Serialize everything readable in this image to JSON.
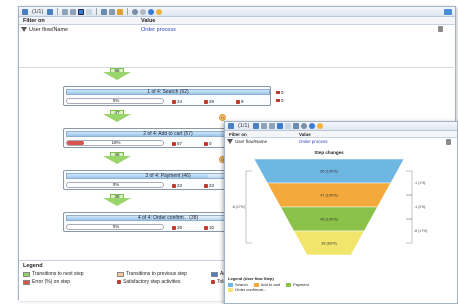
{
  "main": {
    "toolbar": {
      "page_label": "(1/1)"
    },
    "filter": {
      "col_filter_on": "Filter on",
      "col_value": "Value",
      "row_filter_on": "User flow/Name",
      "row_value": "Order process"
    },
    "steps": [
      {
        "title": "1 of 4: Search (62)",
        "pct": "0%",
        "pct_value": 0,
        "a": "24",
        "b": "29",
        "c": "9",
        "exit": "0",
        "entry_arrow": "66"
      },
      {
        "title": "2 of 4: Add to cart (57)",
        "pct": "18%",
        "pct_value": 18,
        "a": "57",
        "b": "0",
        "c": "",
        "exit": "",
        "entry_arrow": "47"
      },
      {
        "title": "3 of 4: Payment (46)",
        "pct": "0%",
        "pct_value": 0,
        "a": "23",
        "b": "23",
        "c": "",
        "exit": "",
        "entry_arrow": "46"
      },
      {
        "title": "4 of 4: Order confirm... (38)",
        "pct": "0%",
        "pct_value": 0,
        "a": "28",
        "b": "10",
        "c": "",
        "exit": "",
        "entry_arrow": "38"
      }
    ],
    "side_exit_first": "0",
    "side_dots": [
      "0",
      "0"
    ],
    "legend": {
      "title": "Legend",
      "items": [
        "Transitions to next step",
        "Transitions to previous step",
        "Activ",
        "Error (%) on step",
        "Satisfactory step activities",
        "Toler"
      ]
    }
  },
  "overlay": {
    "toolbar": {
      "page_label": "(1/1)"
    },
    "filter": {
      "col_filter_on": "Filter on",
      "col_value": "Value",
      "row_filter_on": "User flow/Name",
      "row_value": "Order process"
    },
    "legend": {
      "title": "Legend (User flow Step)",
      "items": [
        "Search",
        "Add to cart",
        "Payment",
        "Order confirmat..."
      ]
    }
  },
  "colors": {
    "accent_blue": "#2a3fb8",
    "step_search": "#6fb7e3",
    "step_cart": "#f3a93b",
    "step_payment": "#8bc34a",
    "step_order": "#f2e56b",
    "error_red": "#d9534f"
  },
  "chart_data": {
    "type": "funnel",
    "title": "Step changes",
    "categories": [
      "Search",
      "Add to cart",
      "Payment",
      "Order confirmat..."
    ],
    "values": [
      66,
      47,
      46,
      38
    ],
    "labels": [
      "66 (100%)",
      "47 (100%)",
      "46 (100%)",
      "38 (83%)"
    ],
    "right_annotations": [
      "-1 (1%)",
      "-1 (2%)",
      "-8 (17%)"
    ],
    "left_annotations": [
      "-8 (17%)"
    ]
  }
}
